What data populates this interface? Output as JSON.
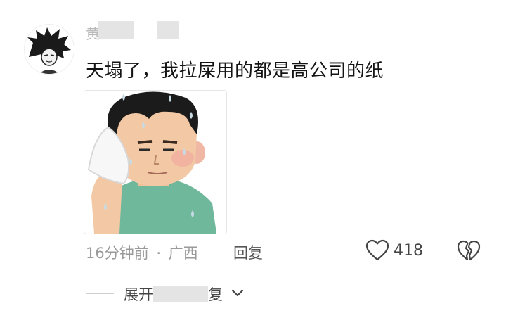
{
  "comment": {
    "username": "黄",
    "text": "天塌了，我拉屎用的都是高公司的纸",
    "time": "16分钟前",
    "separator": "·",
    "location": "广西",
    "reply_label": "回复",
    "like_count": "418",
    "expand_prefix": "展开",
    "expand_suffix": "复"
  },
  "colors": {
    "text_primary": "#141414",
    "text_meta": "#9a9a9a",
    "sticker_shirt": "#6fb89c",
    "sticker_skin": "#f3c8a4",
    "sticker_hair": "#1b1b1b",
    "sticker_sweat": "#c8dbe4"
  },
  "icons": {
    "like": "heart-outline-icon",
    "dislike": "broken-heart-icon",
    "expand": "chevron-down-icon"
  }
}
